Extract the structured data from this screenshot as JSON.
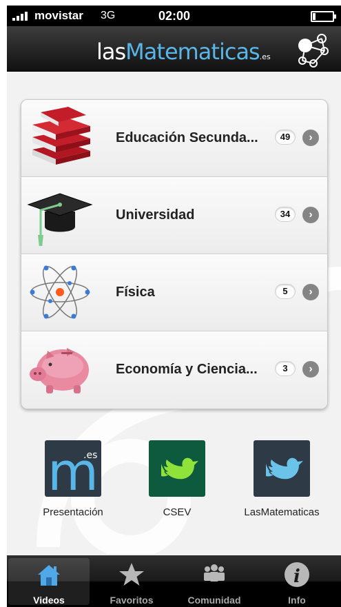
{
  "status_bar": {
    "carrier": "movistar",
    "network": "3G",
    "time": "02:00"
  },
  "header": {
    "logo_prefix": "las",
    "logo_highlight": "M",
    "logo_suffix": "atematicas",
    "logo_domain": ".es",
    "brand_color": "#58b7e8"
  },
  "categories": [
    {
      "label": "Educación Secunda...",
      "count": "49",
      "icon": "books-icon"
    },
    {
      "label": "Universidad",
      "count": "34",
      "icon": "graduation-cap-icon"
    },
    {
      "label": "Física",
      "count": "5",
      "icon": "atom-icon"
    },
    {
      "label": "Economía y Ciencia...",
      "count": "3",
      "icon": "piggy-bank-icon"
    }
  ],
  "links": [
    {
      "label": "Presentación",
      "icon": "lasmatematicas-logo-icon",
      "color": "#2e3a45"
    },
    {
      "label": "CSEV",
      "icon": "twitter-bird-icon",
      "color": "#0e5a3e"
    },
    {
      "label": "LasMatematicas",
      "icon": "twitter-bird-icon",
      "color": "#2e3a45"
    }
  ],
  "tabs": [
    {
      "label": "Videos",
      "icon": "home-icon",
      "active": true
    },
    {
      "label": "Favoritos",
      "icon": "star-icon",
      "active": false
    },
    {
      "label": "Comunidad",
      "icon": "community-icon",
      "active": false
    },
    {
      "label": "Info",
      "icon": "info-icon",
      "active": false
    }
  ]
}
